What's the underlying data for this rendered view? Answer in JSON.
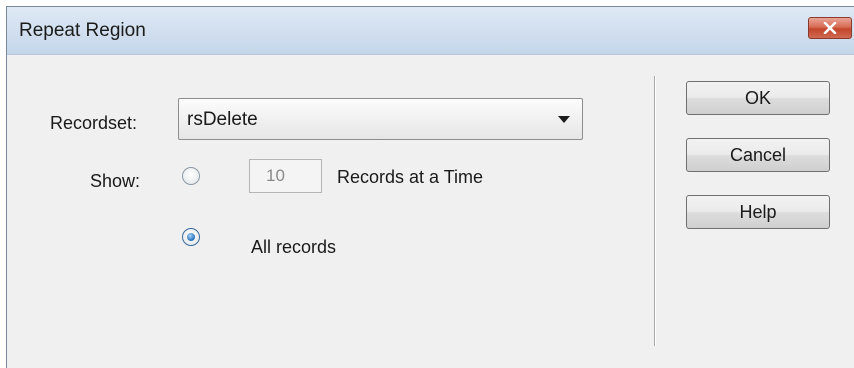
{
  "window": {
    "title": "Repeat Region",
    "close_icon": "close-icon"
  },
  "form": {
    "recordset_label": "Recordset:",
    "recordset_value": "rsDelete",
    "show_label": "Show:",
    "records_count": "10",
    "records_at_time_label": "Records at a Time",
    "all_records_label": "All records",
    "selected_option": "All records"
  },
  "buttons": {
    "ok": "OK",
    "cancel": "Cancel",
    "help": "Help"
  },
  "colors": {
    "close_button": "#c2462c",
    "radio_selected": "#1f6fb8"
  }
}
